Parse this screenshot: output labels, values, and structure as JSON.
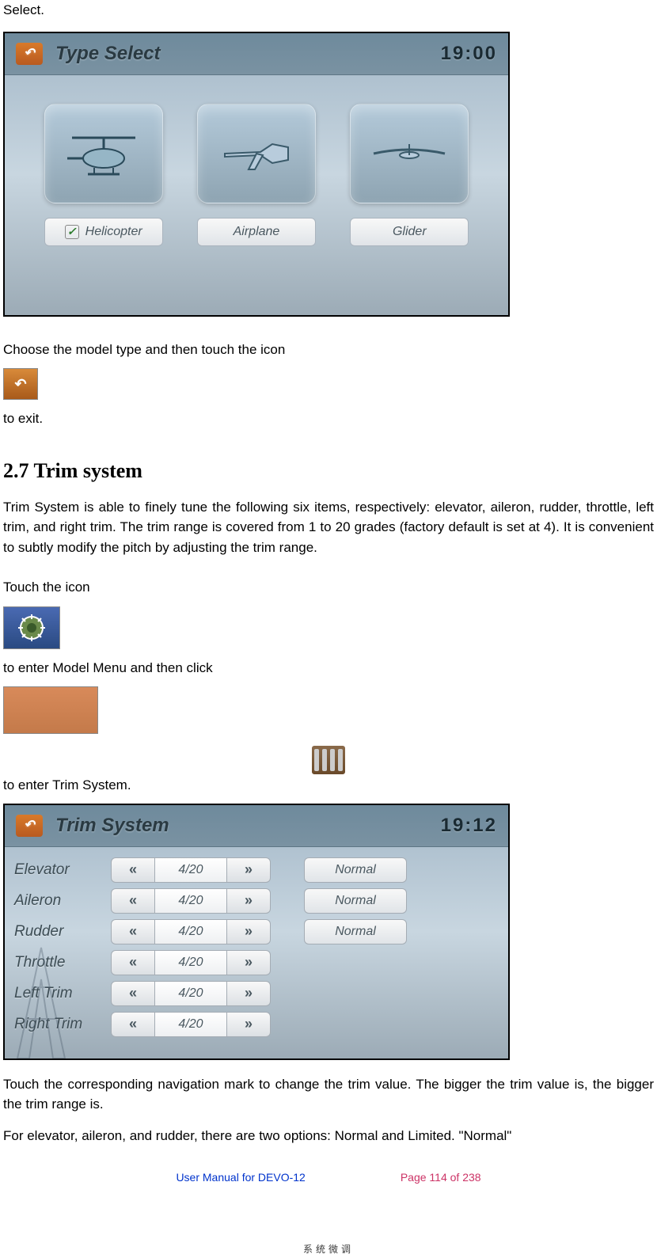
{
  "intro_top": "Select.",
  "screenshot1": {
    "title": "Type Select",
    "clock": "19:00",
    "options": [
      "Helicopter",
      "Airplane",
      "Glider"
    ],
    "selected_index": 0
  },
  "para1_pre": "Choose the model type and then touch the icon ",
  "para1_post": " to exit.",
  "section_heading": "2.7 Trim system",
  "para2": "Trim System is able to finely tune the following six items, respectively: elevator, aileron, rudder, throttle, left trim, and right trim. The trim range is covered from 1 to 20 grades (factory default is set at 4). It is convenient to subtly modify the pitch by adjusting the trim range.",
  "para3_a": "Touch the icon ",
  "para3_b": " to enter Model Menu and then click ",
  "para3_c": " to enter Trim System.",
  "trim_icon_text": "系统微调",
  "screenshot2": {
    "title": "Trim System",
    "clock": "19:12",
    "rows": [
      {
        "label": "Elevator",
        "value": "4/20",
        "mode": "Normal"
      },
      {
        "label": "Aileron",
        "value": "4/20",
        "mode": "Normal"
      },
      {
        "label": "Rudder",
        "value": "4/20",
        "mode": "Normal"
      },
      {
        "label": "Throttle",
        "value": "4/20",
        "mode": null
      },
      {
        "label": "Left Trim",
        "value": "4/20",
        "mode": null
      },
      {
        "label": "Right Trim",
        "value": "4/20",
        "mode": null
      }
    ]
  },
  "para4": "Touch the corresponding navigation mark to change the trim value. The bigger the trim value is, the bigger the trim range is.",
  "para5": "For elevator, aileron, and rudder, there are two options: Normal and Limited. \"Normal\"",
  "footer": {
    "left": "User Manual for DEVO-12",
    "right": "Page 114 of 238"
  }
}
